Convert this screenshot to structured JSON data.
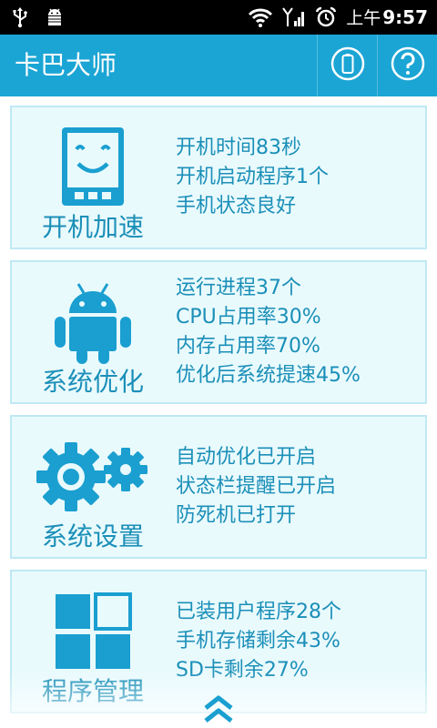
{
  "status_bar": {
    "ampm": "上午",
    "time": "9:57",
    "icons": [
      "usb-icon",
      "android-debug-icon",
      "wifi-icon",
      "signal-icon",
      "alarm-icon"
    ]
  },
  "header": {
    "title": "卡巴大师",
    "actions": [
      "battery-icon",
      "help-icon"
    ]
  },
  "cards": [
    {
      "title": "开机加速",
      "icon": "phone-smiley-icon",
      "lines": [
        "开机时间83秒",
        "开机启动程序1个",
        "手机状态良好"
      ]
    },
    {
      "title": "系统优化",
      "icon": "android-robot-icon",
      "lines": [
        "运行进程37个",
        "CPU占用率30%",
        "内存占用率70%",
        "优化后系统提速45%"
      ]
    },
    {
      "title": "系统设置",
      "icon": "gears-icon",
      "lines": [
        "自动优化已开启",
        "状态栏提醒已开启",
        "防死机已打开"
      ]
    },
    {
      "title": "程序管理",
      "icon": "app-grid-icon",
      "lines": [
        "已装用户程序28个",
        "手机存储剩余43%",
        "SD卡剩余27%"
      ]
    }
  ],
  "colors": {
    "accent": "#1ba5d4",
    "text": "#1b8fb8",
    "card_bg": "#e9fafd",
    "card_border": "#bfe9f3",
    "icon": "#1a9fd0"
  }
}
